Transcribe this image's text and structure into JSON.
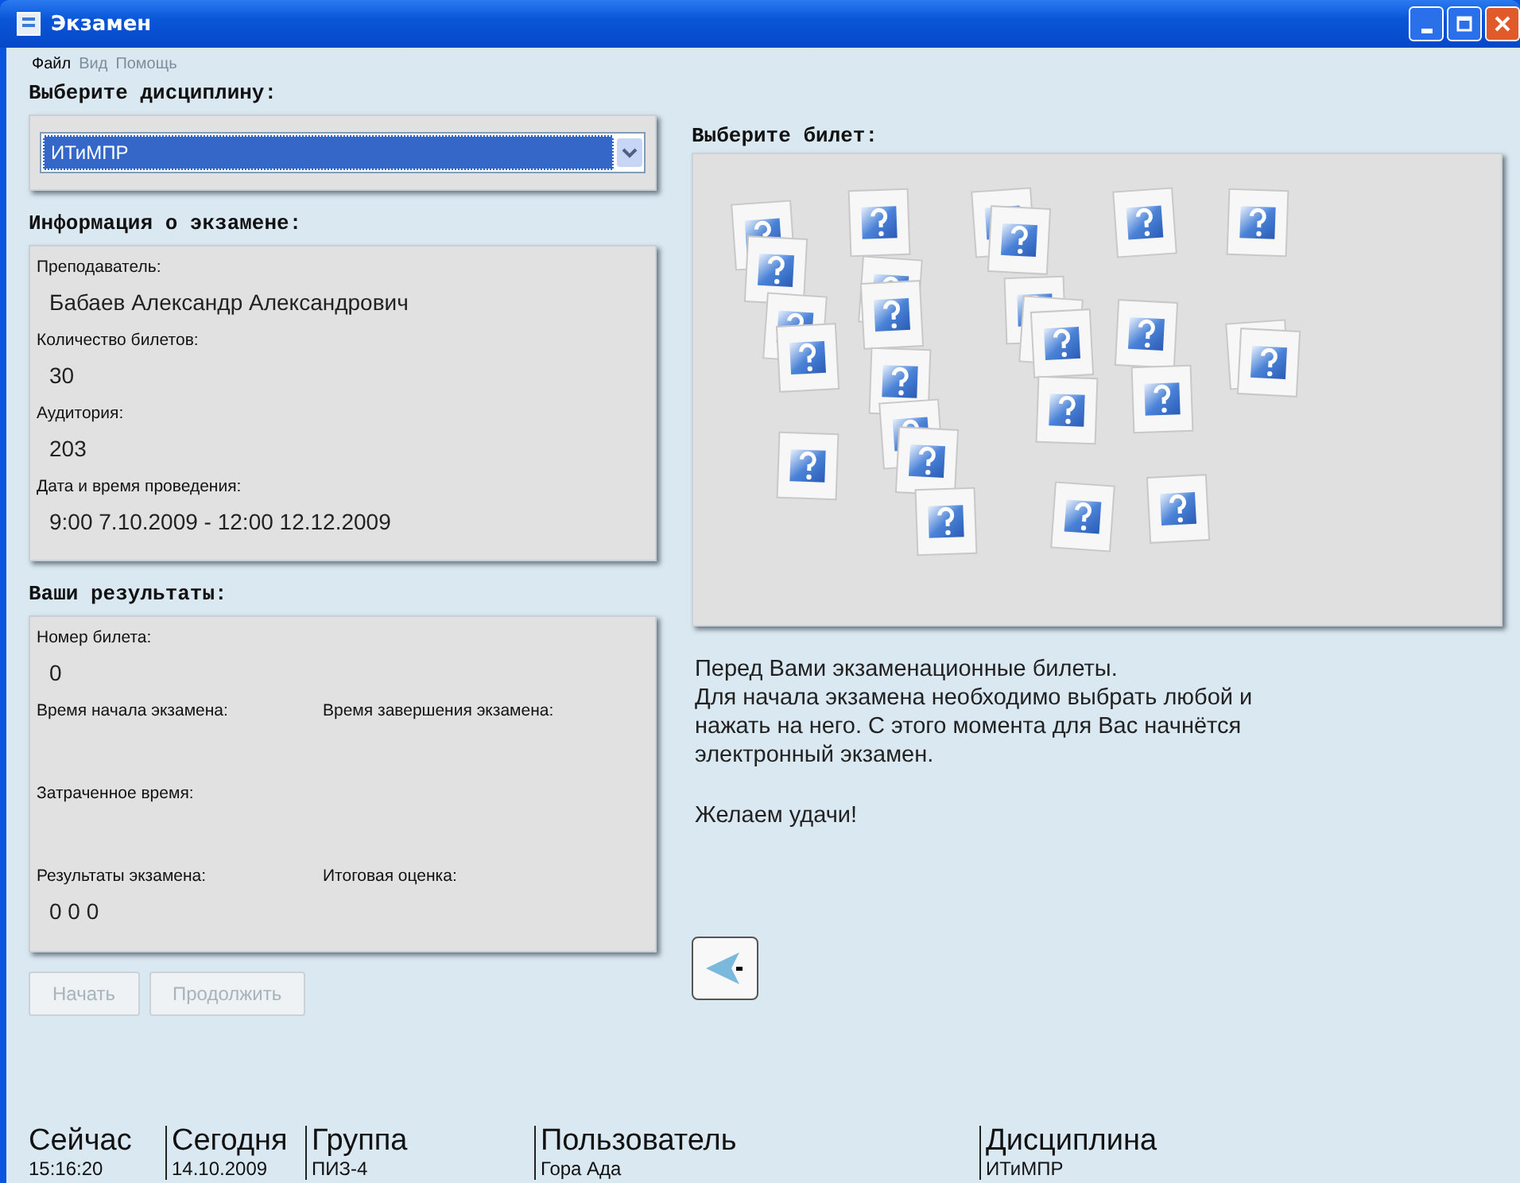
{
  "window": {
    "title": "Экзамен"
  },
  "menu": [
    {
      "label": "Файл",
      "disabled": false
    },
    {
      "label": "Вид",
      "disabled": true
    },
    {
      "label": "Помощь",
      "disabled": true
    }
  ],
  "discipline": {
    "heading": "Выберите дисциплину:",
    "value": "ИТиМПР"
  },
  "info": {
    "heading": "Информация о экзамене:",
    "fields": [
      {
        "label": "Преподаватель:",
        "value": "Бабаев Александр Александрович"
      },
      {
        "label": "Количество билетов:",
        "value": "30"
      },
      {
        "label": "Аудитория:",
        "value": "203"
      },
      {
        "label": "Дата и время проведения:",
        "value": "9:00 7.10.2009 - 12:00 12.12.2009"
      }
    ]
  },
  "results": {
    "heading": "Ваши результаты:",
    "rows": [
      [
        {
          "label": "Номер билета:",
          "value": "0"
        }
      ],
      [
        {
          "label": "Время начала экзамена:"
        },
        {
          "label": "Время завершения экзамена:"
        }
      ],
      [
        {
          "label": "Затраченное время:"
        }
      ],
      [
        {
          "label": "Результаты экзамена:",
          "value": "0 0 0"
        },
        {
          "label": "Итоговая оценка:"
        }
      ]
    ]
  },
  "buttons": [
    {
      "label": "Начать",
      "disabled": true
    },
    {
      "label": "Продолжить",
      "disabled": true
    }
  ],
  "tickets": {
    "heading": "Выберите билет:"
  },
  "instructions": [
    "Перед Вами экзаменационные билеты.",
    "Для начала экзамена необходимо выбрать любой и нажать на него. С этого момента для Вас начнётся электронный экзамен.",
    "Желаем удачи!"
  ],
  "status_bar": [
    {
      "label": "Сейчас",
      "value": "15:16:20"
    },
    {
      "label": "Сегодня",
      "value": "14.10.2009"
    },
    {
      "label": "Группа",
      "value": "ПИЗ-4"
    },
    {
      "label": "Пользователь",
      "value": "Гора Ада"
    },
    {
      "label": "Дисциплина",
      "value": "ИТиМПР"
    }
  ]
}
